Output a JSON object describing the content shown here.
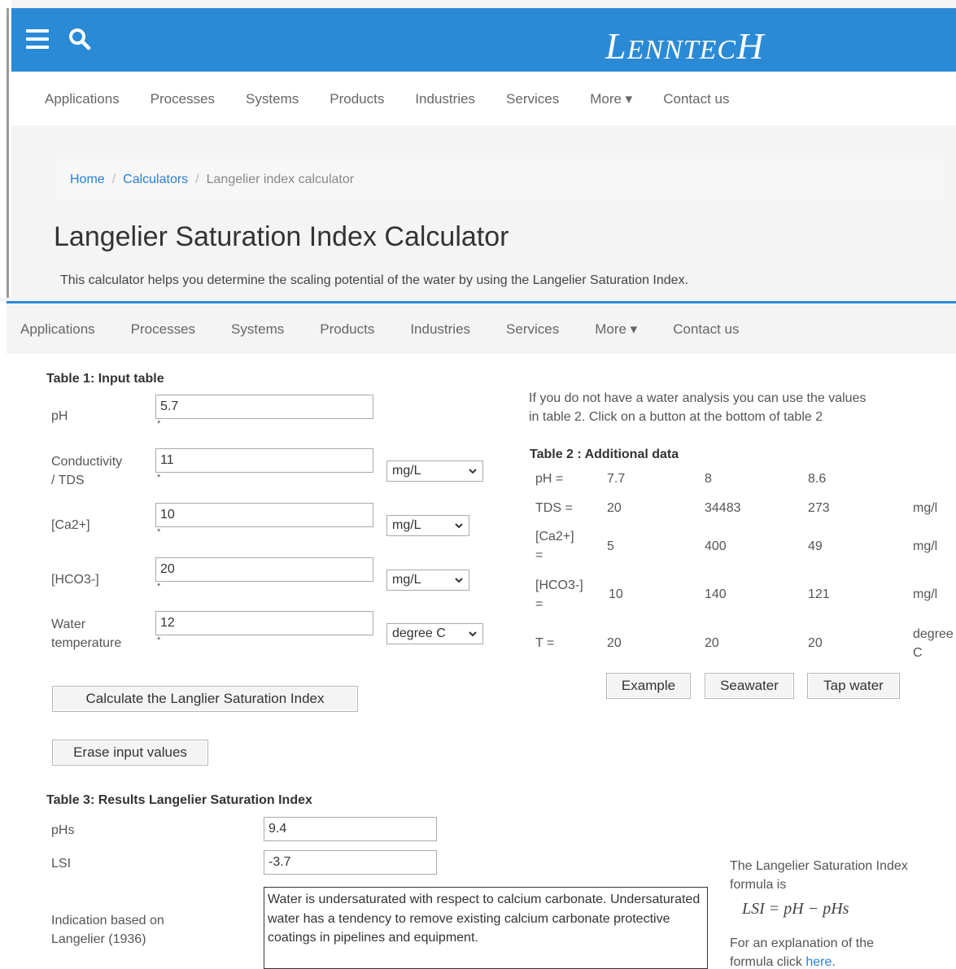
{
  "header": {
    "logo": "LENNTECH",
    "colors": {
      "header_blue": "#2a8ad6",
      "link_blue": "#2a7fd4"
    }
  },
  "nav": {
    "items": [
      "Applications",
      "Processes",
      "Systems",
      "Products",
      "Industries",
      "Services",
      "More",
      "Contact us"
    ]
  },
  "breadcrumb": {
    "home": "Home",
    "sep": "/",
    "calculators": "Calculators",
    "current": "Langelier index calculator"
  },
  "page": {
    "title": "Langelier Saturation Index Calculator",
    "description": "This calculator helps you determine the scaling potential of the water by using the Langelier Saturation Index."
  },
  "table1": {
    "title": "Table 1: Input table",
    "rows": [
      {
        "label_line1": "pH",
        "label_line2": "",
        "value": "5.7",
        "unit": ""
      },
      {
        "label_line1": "Conductivity",
        "label_line2": "/ TDS",
        "value": "11",
        "unit": "mg/L"
      },
      {
        "label_line1": "[Ca2+]",
        "label_line2": "",
        "value": "10",
        "unit": "mg/L"
      },
      {
        "label_line1": "[HCO3-]",
        "label_line2": "",
        "value": "20",
        "unit": "mg/L"
      },
      {
        "label_line1": "Water",
        "label_line2": "temperature",
        "value": "12",
        "unit": "degree C"
      }
    ],
    "star": "*"
  },
  "buttons": {
    "calculate": "Calculate the Langlier Saturation Index",
    "erase": "Erase input values",
    "example": "Example",
    "seawater": "Seawater",
    "tapwater": "Tap water"
  },
  "info": {
    "line1": "If you do not have a water analysis you can use the values",
    "line2": "in table 2. Click on a button at the bottom of table 2"
  },
  "table2": {
    "title": "Table 2 : Additional data",
    "rows": [
      {
        "label": "pH =",
        "label2": "",
        "v1": "7.7",
        "v2": "8",
        "v3": "8.6",
        "unit": "",
        "unit2": ""
      },
      {
        "label": "TDS =",
        "label2": "",
        "v1": "20",
        "v2": "34483",
        "v3": "273",
        "unit": "mg/l",
        "unit2": ""
      },
      {
        "label": "[Ca2+]",
        "label2": "=",
        "v1": "5",
        "v2": "400",
        "v3": "49",
        "unit": "mg/l",
        "unit2": ""
      },
      {
        "label": "[HCO3-]",
        "label2": "=",
        "v1": "10",
        "v2": "140",
        "v3": "121",
        "unit": "mg/l",
        "unit2": ""
      },
      {
        "label": "T =",
        "label2": "",
        "v1": "20",
        "v2": "20",
        "v3": "20",
        "unit": "degree",
        "unit2": "C"
      }
    ]
  },
  "table3": {
    "title": "Table 3: Results Langelier Saturation Index",
    "phs_label": "pHs",
    "phs_value": "9.4",
    "lsi_label": "LSI",
    "lsi_value": "-3.7",
    "indication_label_line1": "Indication based on",
    "indication_label_line2": "Langelier (1936)",
    "indication_text": "Water is undersaturated with respect to calcium carbonate. Undersaturated water has a tendency to remove existing calcium carbonate protective coatings in pipelines and equipment."
  },
  "formula": {
    "line1": "The Langelier Saturation Index",
    "line2": "formula is",
    "expression": "LSI = pH − pHs",
    "expl1": "For an explanation of the",
    "expl2_prefix": "formula click ",
    "expl2_link": "here"
  }
}
